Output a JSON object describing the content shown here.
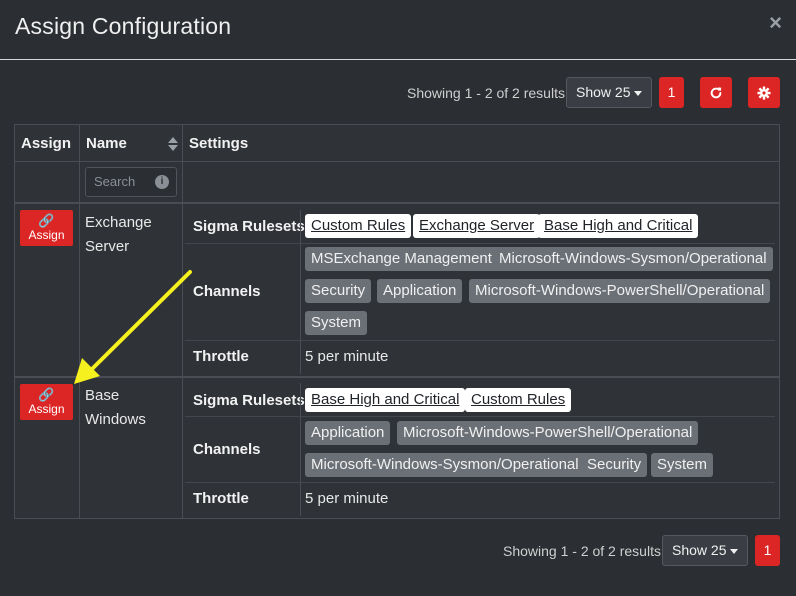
{
  "modal": {
    "title": "Assign Configuration",
    "close_icon": "×"
  },
  "pagination_top": {
    "showing": "Showing 1 - 2 of 2 results",
    "show_select": "Show 25",
    "page": "1",
    "refresh_icon": "refresh-icon",
    "settings_icon": "gear-icon"
  },
  "table": {
    "headers": [
      "Assign",
      "Name",
      "Settings"
    ],
    "search_placeholder": "Search",
    "rows": [
      {
        "assign_label": "Assign",
        "name_lines": [
          "Exchange",
          "Server"
        ],
        "settings": {
          "rulesets_label": "Sigma Rulesets",
          "rulesets": [
            "Custom Rules",
            "Exchange Server",
            "Base High and Critical"
          ],
          "channels_label": "Channels",
          "channels": [
            "MSExchange Management",
            "Microsoft-Windows-Sysmon/Operational",
            "Security",
            "Application",
            "Microsoft-Windows-PowerShell/Operational",
            "System"
          ],
          "throttle_label": "Throttle",
          "throttle": "5 per minute"
        }
      },
      {
        "assign_label": "Assign",
        "name_lines": [
          "Base",
          "Windows"
        ],
        "settings": {
          "rulesets_label": "Sigma Rulesets",
          "rulesets": [
            "Base High and Critical",
            "Custom Rules"
          ],
          "channels_label": "Channels",
          "channels": [
            "Application",
            "Microsoft-Windows-PowerShell/Operational",
            "Microsoft-Windows-Sysmon/Operational",
            "Security",
            "System"
          ],
          "throttle_label": "Throttle",
          "throttle": "5 per minute"
        }
      }
    ]
  },
  "pagination_bottom": {
    "showing": "Showing 1 - 2 of 2 results",
    "show_select": "Show 25",
    "page": "1"
  },
  "colors": {
    "accent_red": "#dc2626",
    "annotation_arrow": "#f5f01e"
  }
}
